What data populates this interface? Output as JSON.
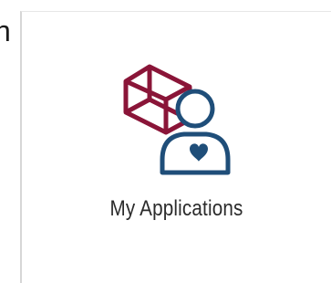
{
  "previous_tile": {
    "partial_label": "n"
  },
  "tile": {
    "label": "My Applications",
    "icon": "cube-user-heart-icon"
  },
  "colors": {
    "cube": "#8a1538",
    "person": "#1f4e79",
    "border": "#d6d6d6",
    "text": "#2b2b2b"
  }
}
